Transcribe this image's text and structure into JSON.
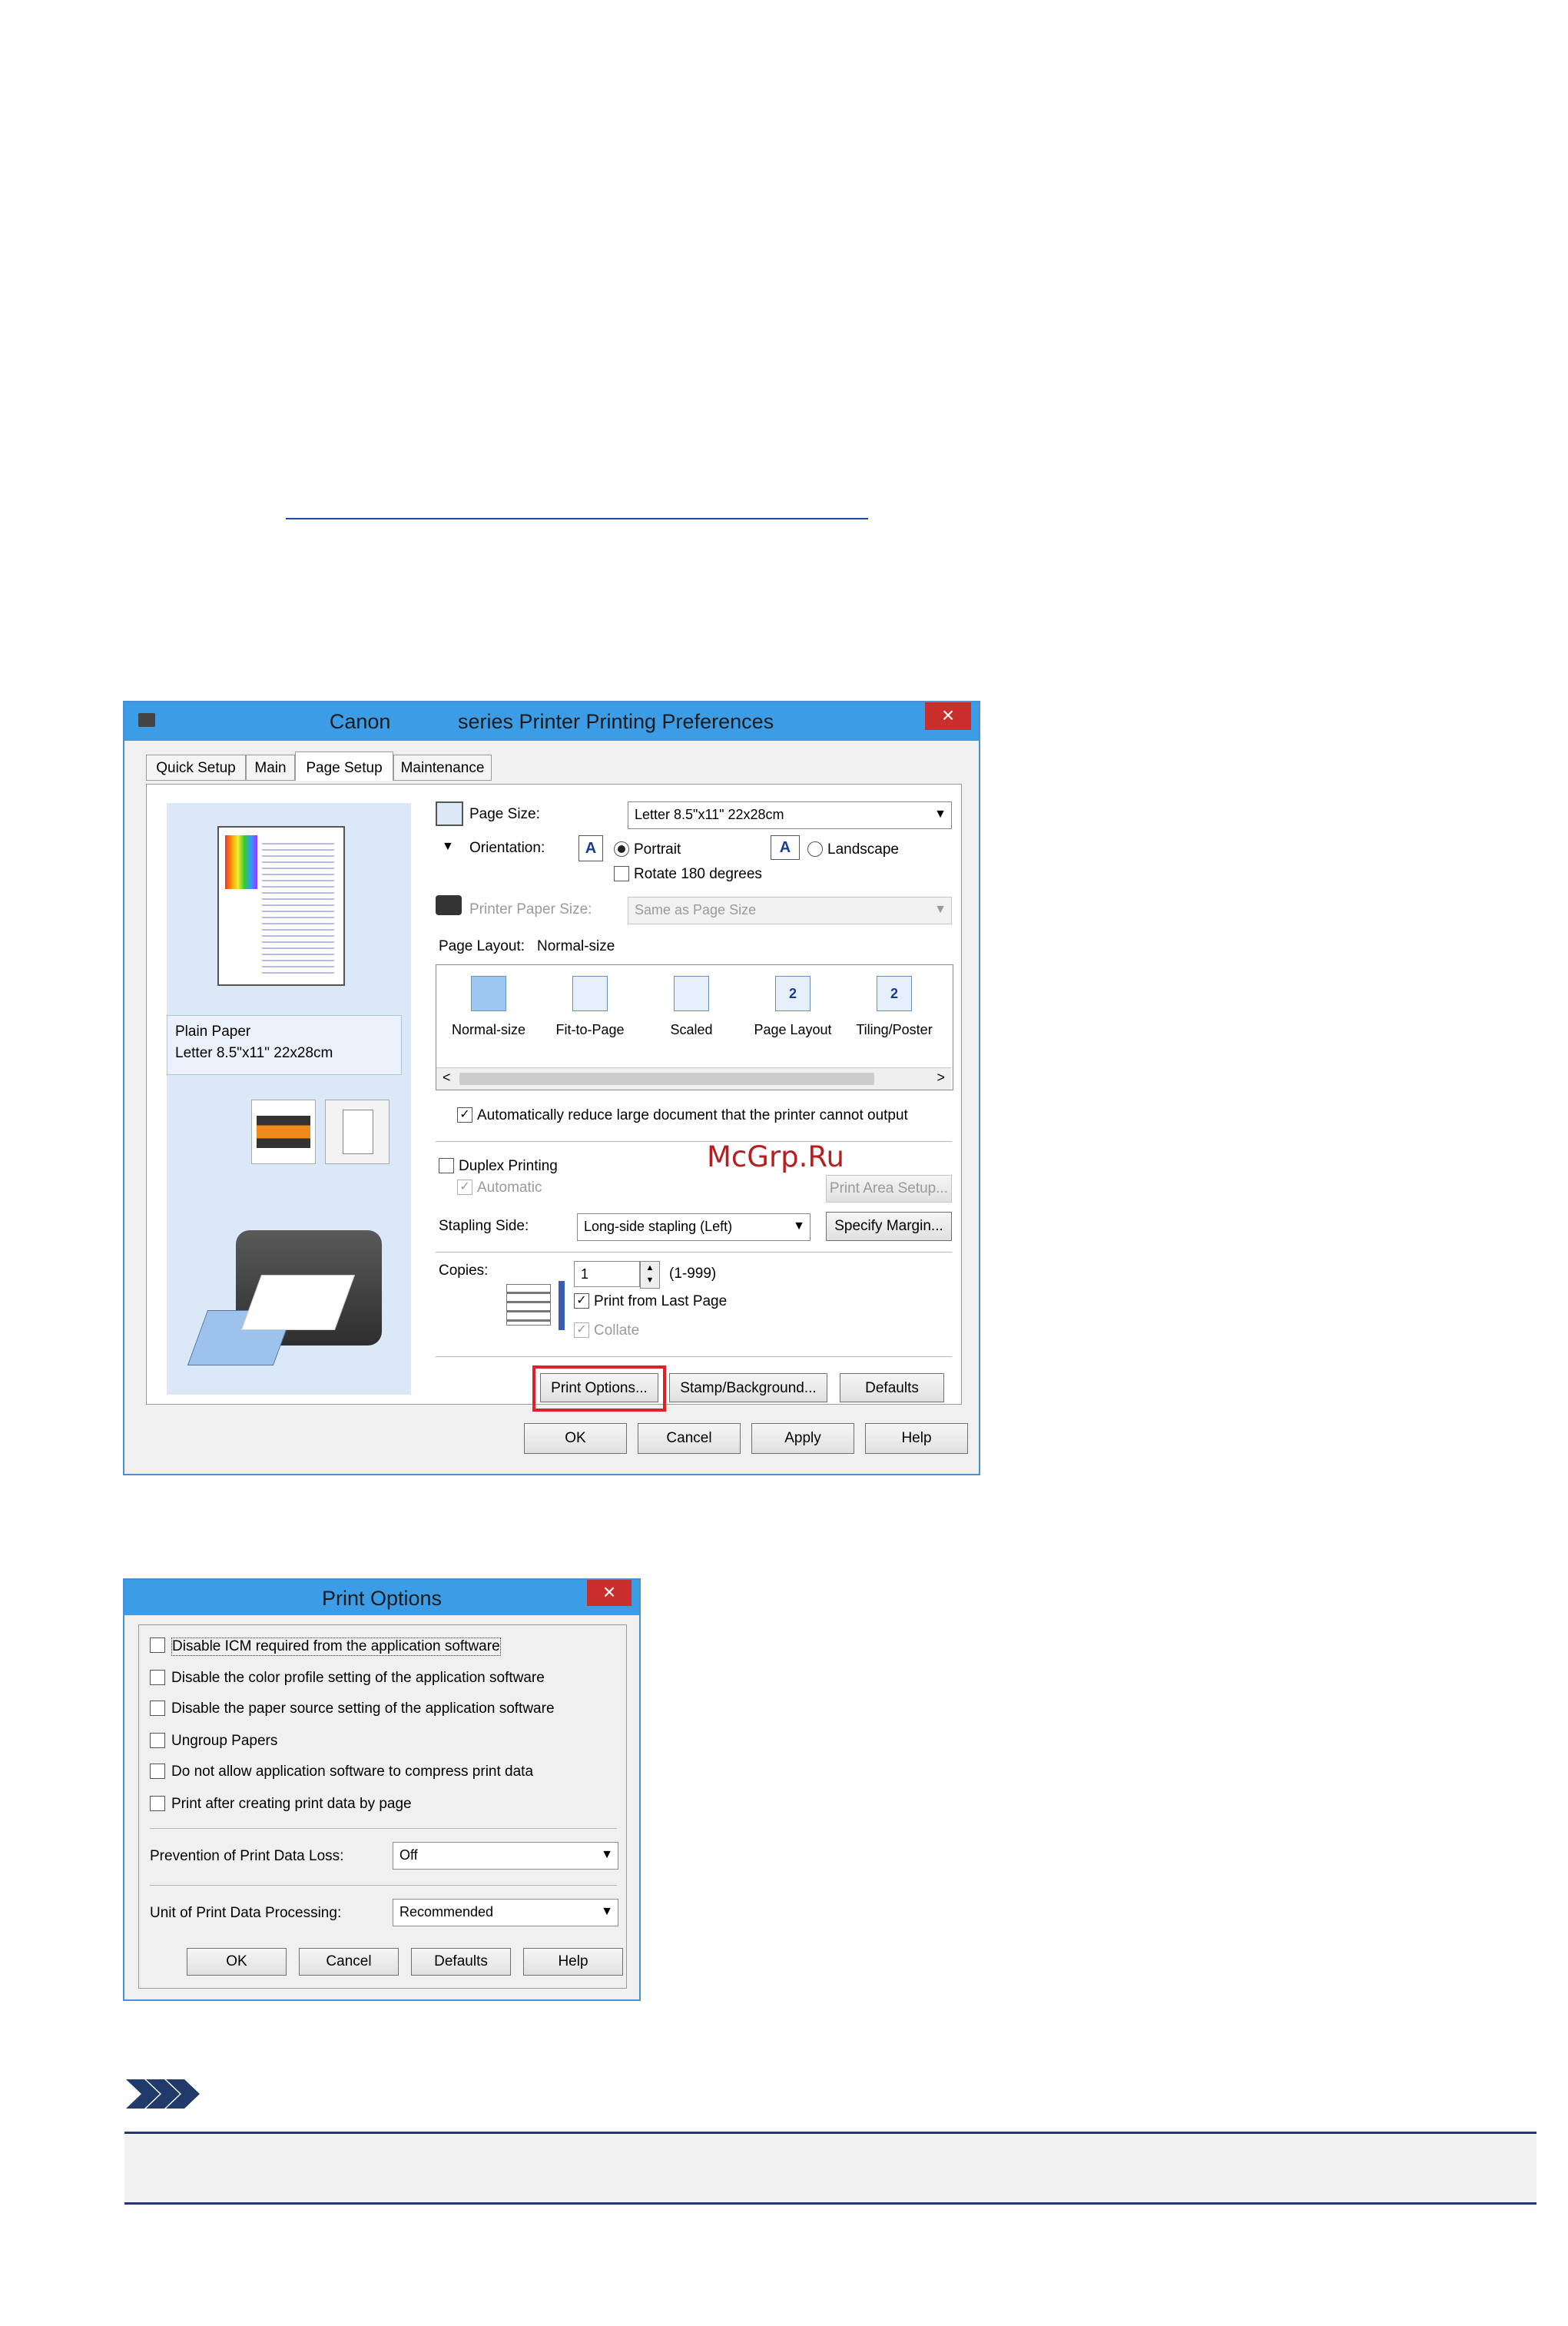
{
  "watermark": "McGrp.Ru",
  "dialog1": {
    "title_left": "Canon",
    "title_right": "series Printer Printing Preferences",
    "close": "×",
    "tabs": [
      "Quick Setup",
      "Main",
      "Page Setup",
      "Maintenance"
    ],
    "preview_info": {
      "line1": "Plain Paper",
      "line2": "Letter 8.5\"x11\" 22x28cm"
    },
    "page_size_label": "Page Size:",
    "page_size_value": "Letter 8.5\"x11\" 22x28cm",
    "orientation_label": "Orientation:",
    "portrait": "Portrait",
    "landscape": "Landscape",
    "rotate": "Rotate 180 degrees",
    "printer_paper_size_label": "Printer Paper Size:",
    "printer_paper_size_value": "Same as Page Size",
    "page_layout_label": "Page Layout:",
    "page_layout_value": "Normal-size",
    "layouts": [
      "Normal-size",
      "Fit-to-Page",
      "Scaled",
      "Page Layout",
      "Tiling/Poster"
    ],
    "auto_reduce": "Automatically reduce large document that the printer cannot output",
    "duplex": "Duplex Printing",
    "automatic": "Automatic",
    "print_area_setup": "Print Area Setup...",
    "stapling_side_label": "Stapling Side:",
    "stapling_side_value": "Long-side stapling (Left)",
    "specify_margin": "Specify Margin...",
    "copies_label": "Copies:",
    "copies_value": "1",
    "copies_range": "(1-999)",
    "print_from_last": "Print from Last Page",
    "collate": "Collate",
    "print_options": "Print Options...",
    "stamp_background": "Stamp/Background...",
    "defaults": "Defaults",
    "ok": "OK",
    "cancel": "Cancel",
    "apply": "Apply",
    "help": "Help",
    "highlight_color": "#e21e26"
  },
  "dialog2": {
    "title": "Print Options",
    "close": "×",
    "options": [
      "Disable ICM required from the application software",
      "Disable the color profile setting of the application software",
      "Disable the paper source setting of the application software",
      "Ungroup Papers",
      "Do not allow application software to compress print data",
      "Print after creating print data by page"
    ],
    "prevention_label": "Prevention of Print Data Loss:",
    "prevention_value": "Off",
    "unit_label": "Unit of Print Data Processing:",
    "unit_value": "Recommended",
    "ok": "OK",
    "cancel": "Cancel",
    "defaults": "Defaults",
    "help": "Help"
  }
}
